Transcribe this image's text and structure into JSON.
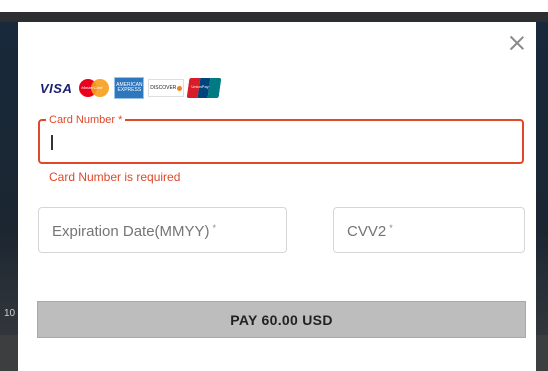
{
  "backdrop": {
    "fragment_text": "10"
  },
  "modal": {
    "card_brands": [
      {
        "name": "visa-icon",
        "label": "VISA"
      },
      {
        "name": "mastercard-icon",
        "label": "MasterCard"
      },
      {
        "name": "amex-icon",
        "label": "AMERICAN EXPRESS"
      },
      {
        "name": "discover-icon",
        "label": "DISCOVER"
      },
      {
        "name": "unionpay-icon",
        "label": "UnionPay"
      }
    ],
    "card_number": {
      "label": "Card Number",
      "required_mark": "*",
      "value": "",
      "error": "Card Number is required"
    },
    "expiration": {
      "placeholder": "Expiration Date(MMYY)",
      "required_mark": "*"
    },
    "cvv": {
      "placeholder": "CVV2",
      "required_mark": "*"
    },
    "pay_button": {
      "label": "PAY 60.00 USD"
    }
  },
  "colors": {
    "error": "#e0482a",
    "button_bg": "#bdbdbd",
    "backdrop": "#1c2631"
  }
}
